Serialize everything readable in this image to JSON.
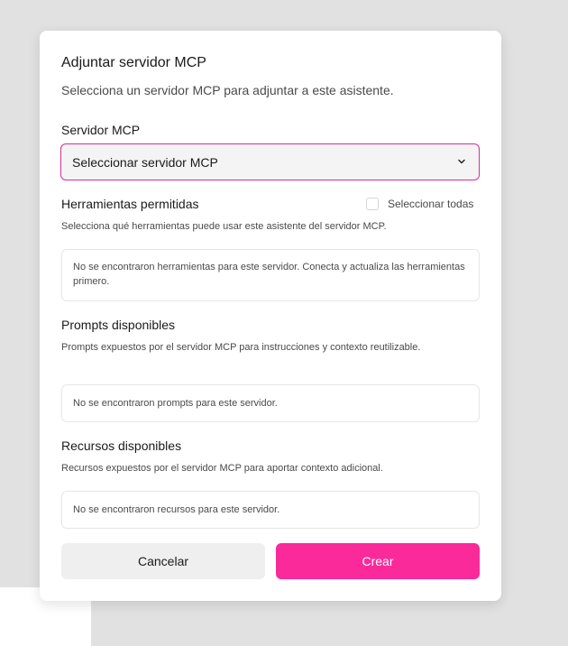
{
  "dialog": {
    "title": "Adjuntar servidor MCP",
    "description": "Selecciona un servidor MCP para adjuntar a este asistente."
  },
  "server": {
    "label": "Servidor MCP",
    "selected": "Seleccionar servidor MCP",
    "icon": "chevron-down-icon"
  },
  "tools": {
    "label": "Herramientas permitidas",
    "select_all_label": "Seleccionar todas",
    "select_all_checked": false,
    "help": "Selecciona qué herramientas puede usar este asistente del servidor MCP.",
    "empty": "No se encontraron herramientas para este servidor. Conecta y actualiza las herramientas primero."
  },
  "prompts": {
    "label": "Prompts disponibles",
    "help": "Prompts expuestos por el servidor MCP para instrucciones y contexto reutilizable.",
    "empty": "No se encontraron prompts para este servidor."
  },
  "resources": {
    "label": "Recursos disponibles",
    "help": "Recursos expuestos por el servidor MCP para aportar contexto adicional.",
    "empty": "No se encontraron recursos para este servidor."
  },
  "actions": {
    "cancel_label": "Cancelar",
    "create_label": "Crear"
  },
  "colors": {
    "accent": "#fa2a9b",
    "select_border": "#d82e93",
    "backdrop": "#e1e1e1"
  }
}
